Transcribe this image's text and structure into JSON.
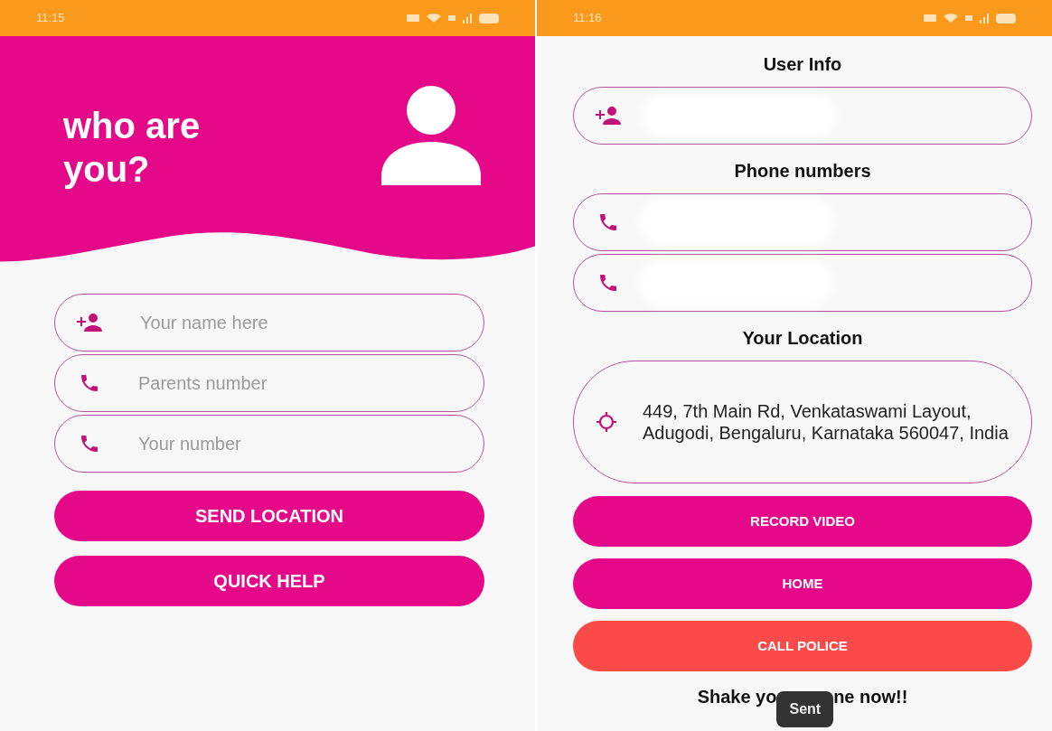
{
  "left_screen": {
    "status_bar": {
      "time": "11:15"
    },
    "header": {
      "title": "who are you?"
    },
    "fields": [
      {
        "kind": "person",
        "placeholder": "Your name here"
      },
      {
        "kind": "phone",
        "placeholder": "Parents number"
      },
      {
        "kind": "phone",
        "placeholder": "Your number"
      }
    ],
    "buttons": [
      {
        "label": "SEND LOCATION",
        "kind": "primary"
      },
      {
        "label": "QUICK HELP",
        "kind": "primary"
      }
    ]
  },
  "right_screen": {
    "status_bar": {
      "time": "11:16"
    },
    "sections": [
      {
        "title": "User Info",
        "fields": [
          {
            "kind": "person",
            "blurred": true
          }
        ]
      },
      {
        "title": "Phone numbers",
        "fields": [
          {
            "kind": "phone",
            "blurred": true
          },
          {
            "kind": "phone",
            "blurred": true
          }
        ]
      },
      {
        "title": "Your Location",
        "fields": [
          {
            "kind": "location",
            "value": "449, 7th Main Rd, Venkataswami Layout, Adugodi, Bengaluru, Karnataka 560047, India"
          }
        ]
      }
    ],
    "buttons": [
      {
        "label": "RECORD VIDEO",
        "kind": "primary"
      },
      {
        "label": "HOME",
        "kind": "primary"
      },
      {
        "label": "CALL POLICE",
        "kind": "danger"
      }
    ],
    "shake_text": {
      "before": "Shake yo",
      "after": "ne now!!"
    },
    "toast": "Sent"
  }
}
